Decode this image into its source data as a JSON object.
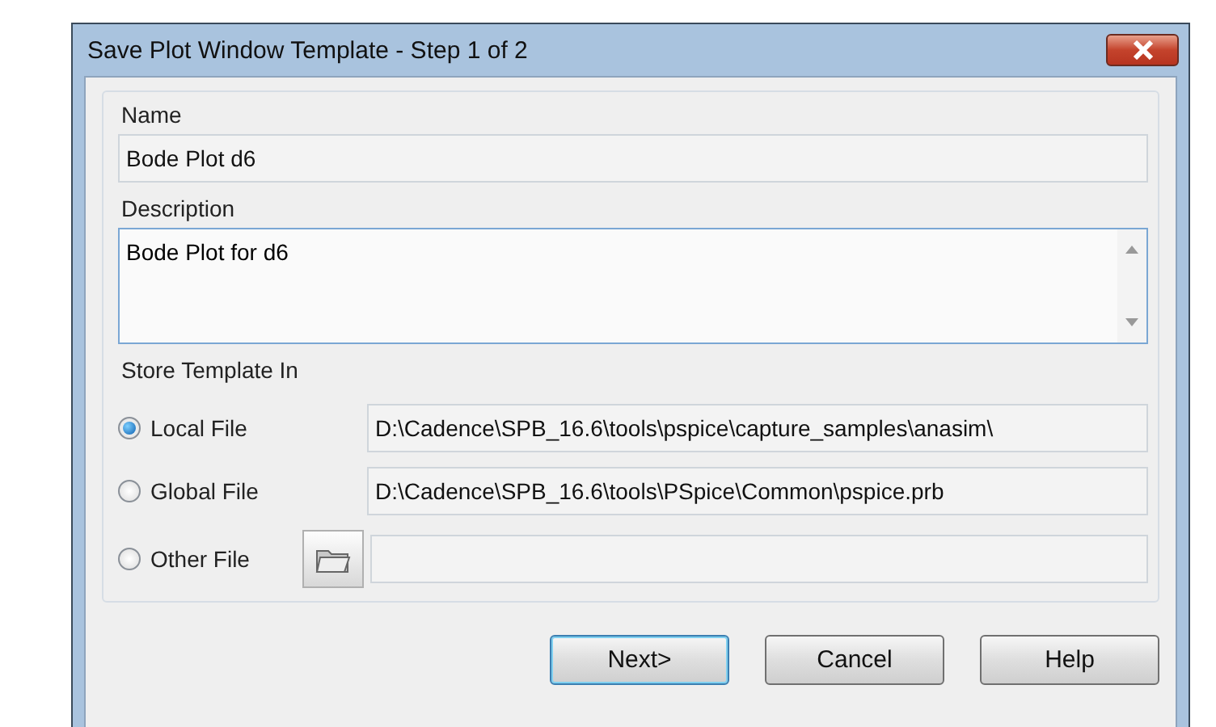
{
  "window": {
    "title": "Save Plot Window Template - Step 1 of 2"
  },
  "name": {
    "label": "Name",
    "value": "Bode Plot d6"
  },
  "description": {
    "label": "Description",
    "value": "Bode Plot for d6"
  },
  "store": {
    "label": "Store Template In",
    "options": [
      {
        "label": "Local File",
        "selected": true,
        "value": "D:\\Cadence\\SPB_16.6\\tools\\pspice\\capture_samples\\anasim\\",
        "browse": false
      },
      {
        "label": "Global File",
        "selected": false,
        "value": "D:\\Cadence\\SPB_16.6\\tools\\PSpice\\Common\\pspice.prb",
        "browse": false
      },
      {
        "label": "Other File",
        "selected": false,
        "browse": true
      }
    ]
  },
  "buttons": [
    {
      "label": "Next>",
      "default": true
    },
    {
      "label": "Cancel",
      "default": false
    },
    {
      "label": "Help",
      "default": false
    }
  ]
}
